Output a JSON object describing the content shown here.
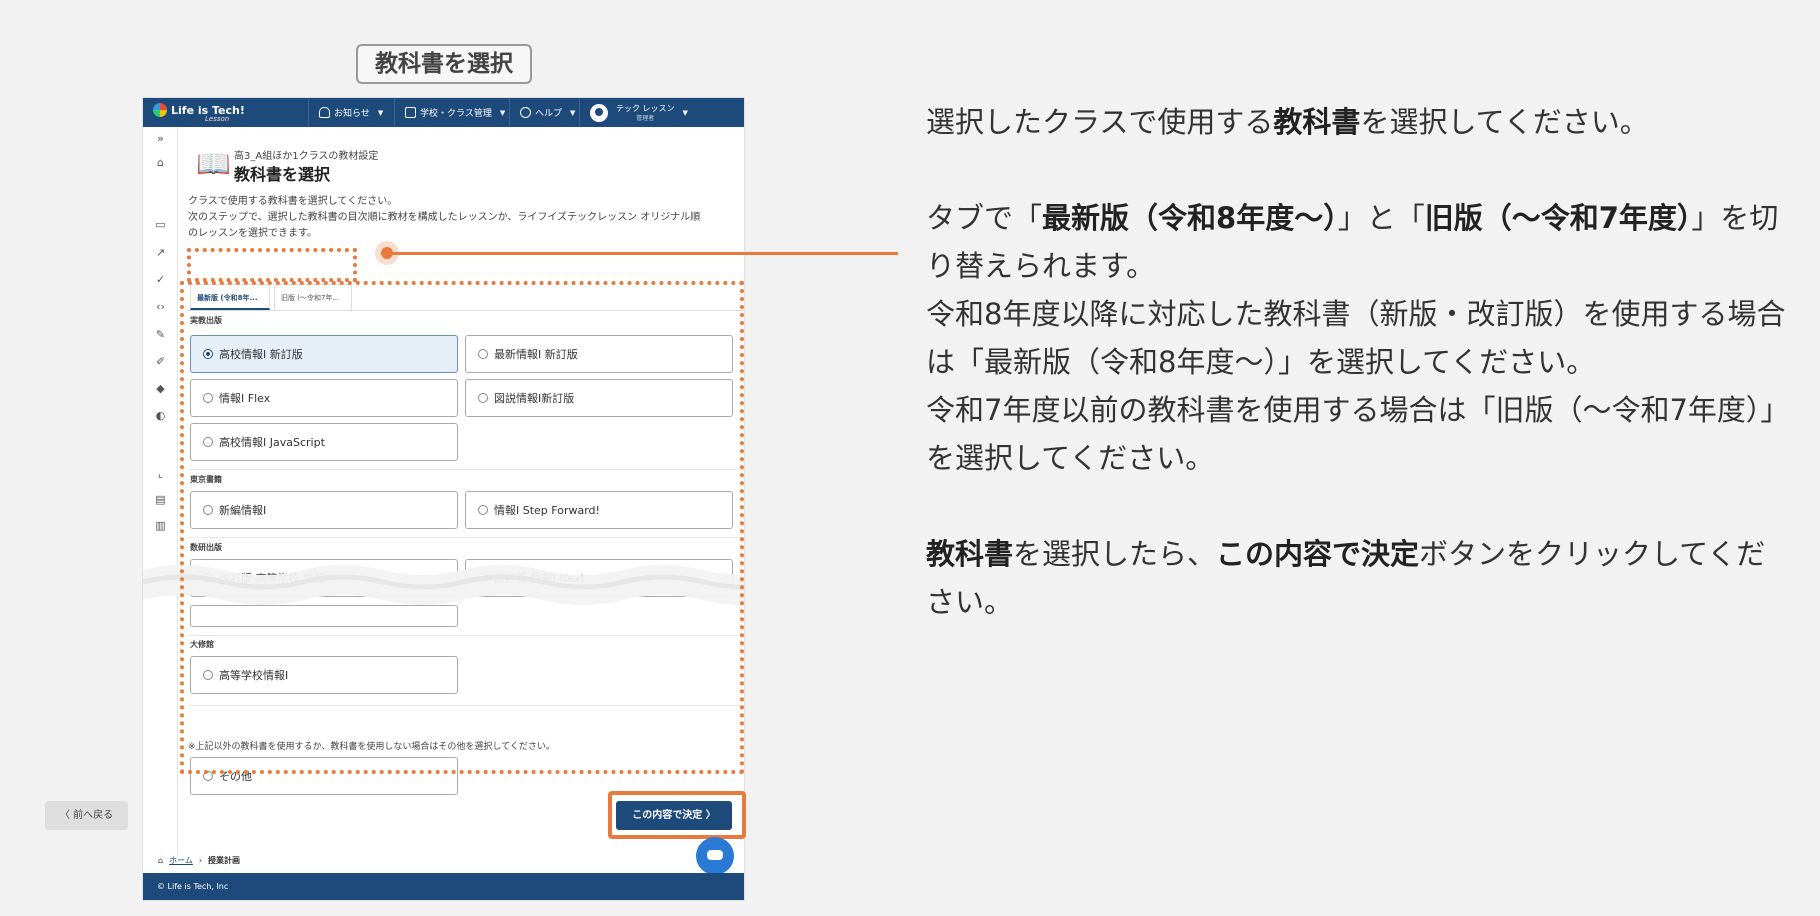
{
  "step_label": "教科書を選択",
  "topbar": {
    "logo": "Life is Tech!",
    "logo_sub": "Lesson",
    "notice": "お知らせ",
    "school": "学校・クラス管理",
    "help": "ヘルプ",
    "user_name": "テック レッスン",
    "user_role": "管理者"
  },
  "page": {
    "subtitle": "高3_A組ほか1クラスの教材設定",
    "title": "教科書を選択",
    "desc_line1": "クラスで使用する教科書を選択してください。",
    "desc_line2": "次のステップで、選択した教科書の目次順に教材を構成したレッスンか、ライフイズテックレッスン オリジナル順",
    "desc_line3": "のレッスンを選択できます。",
    "tab_new": "最新版 (令和8年...",
    "tab_old": "旧版 (〜令和7年...",
    "note": "※上記以外の教科書を使用するか、教科書を使用しない場合はその他を選択してください。"
  },
  "publishers": {
    "p1": "実教出版",
    "p2": "東京書籍",
    "p3": "数研出版",
    "p4": "大修館"
  },
  "options": {
    "o1": "高校情報Ⅰ 新訂版",
    "o2": "最新情報Ⅰ 新訂版",
    "o3": "情報Ⅰ Flex",
    "o4": "図説情報Ⅰ新訂版",
    "o5": "高校情報Ⅰ JavaScript",
    "o6": "新編情報Ⅰ",
    "o7": "情報Ⅰ Step Forward!",
    "o8": "改訂版 高等学校 情報Ⅰ",
    "o9": "改訂版 情報Ⅰ Next",
    "o10": "高等学校情報Ⅰ",
    "o11": "その他"
  },
  "buttons": {
    "back": "〈 前へ戻る",
    "ok": "この内容で決定 〉"
  },
  "breadcrumb": {
    "home": "ホーム",
    "current": "授業計画"
  },
  "footer": "© Life is Tech, Inc",
  "instructions": {
    "p1_a": "選択したクラスで使用する",
    "p1_b": "教科書",
    "p1_c": "を選択してください。",
    "p2_a": "タブで「",
    "p2_b": "最新版（令和8年度〜）",
    "p2_c": "」と「",
    "p2_d": "旧版（〜令和7年度）",
    "p2_e": "」を切り替えられます。",
    "p2_f": "令和8年度以降に対応した教科書（新版・改訂版）を使用する場合は「最新版（令和8年度〜）」を選択してください。",
    "p2_g": "令和7年度以前の教科書を使用する場合は「旧版（〜令和7年度）」を選択してください。",
    "p3_a": "教科書",
    "p3_b": "を選択したら、",
    "p3_c": "この内容で決定",
    "p3_d": "ボタンをクリックしてください。"
  },
  "colors": {
    "navy": "#1d4a7a",
    "highlight": "#e87a3e"
  }
}
